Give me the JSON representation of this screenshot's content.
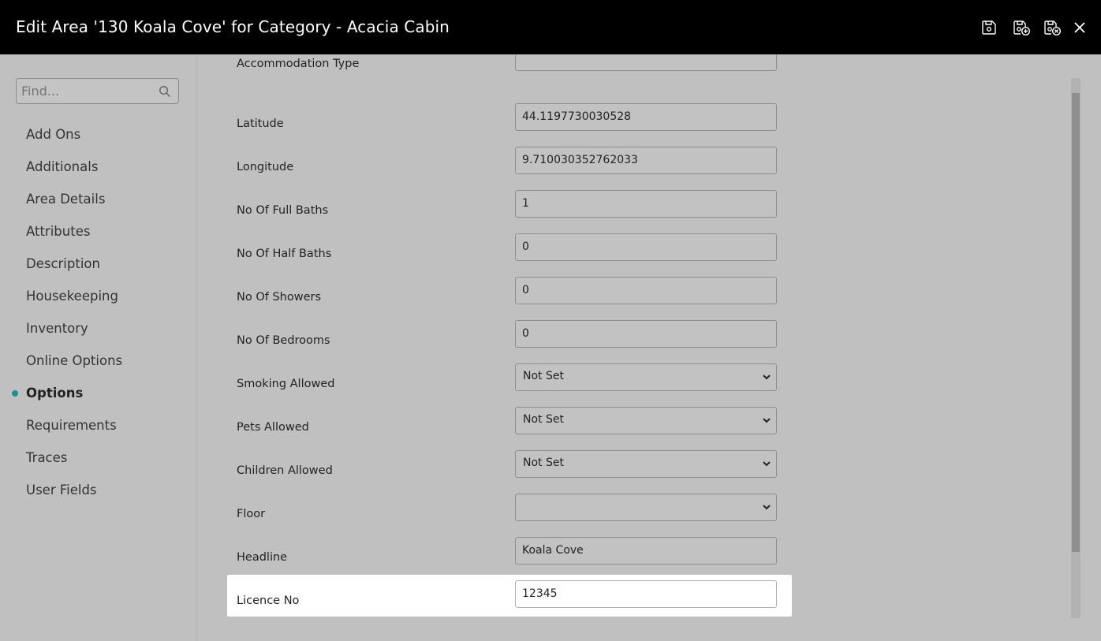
{
  "window": {
    "title": "Edit Area '130 Koala Cove' for Category - Acacia Cabin",
    "toolbar": [
      "save-icon",
      "save-and-new-icon",
      "save-and-close-icon",
      "close-icon"
    ]
  },
  "sidebar": {
    "search_placeholder": "Find...",
    "items": [
      {
        "label": "Add Ons"
      },
      {
        "label": "Additionals"
      },
      {
        "label": "Area Details"
      },
      {
        "label": "Attributes"
      },
      {
        "label": "Description"
      },
      {
        "label": "Housekeeping"
      },
      {
        "label": "Inventory"
      },
      {
        "label": "Online Options"
      },
      {
        "label": "Options",
        "active": true
      },
      {
        "label": "Requirements"
      },
      {
        "label": "Traces"
      },
      {
        "label": "User Fields"
      }
    ],
    "accent_color": "#1a8f96"
  },
  "form": {
    "partial_label": "Accommodation Type",
    "fields": [
      {
        "label": "Latitude",
        "value": "44.1197730030528",
        "type": "text"
      },
      {
        "label": "Longitude",
        "value": "9.710030352762033",
        "type": "text"
      },
      {
        "label": "No Of Full Baths",
        "value": "1",
        "type": "text"
      },
      {
        "label": "No Of Half Baths",
        "value": "0",
        "type": "text"
      },
      {
        "label": "No Of Showers",
        "value": "0",
        "type": "text"
      },
      {
        "label": "No Of Bedrooms",
        "value": "0",
        "type": "text"
      },
      {
        "label": "Smoking Allowed",
        "value": "Not Set",
        "type": "select"
      },
      {
        "label": "Pets Allowed",
        "value": "Not Set",
        "type": "select"
      },
      {
        "label": "Children Allowed",
        "value": "Not Set",
        "type": "select"
      },
      {
        "label": "Floor",
        "value": "",
        "type": "select"
      },
      {
        "label": "Headline",
        "value": "Koala Cove",
        "type": "text"
      },
      {
        "label": "Licence No",
        "value": "12345",
        "type": "text",
        "highlighted": true
      }
    ]
  }
}
